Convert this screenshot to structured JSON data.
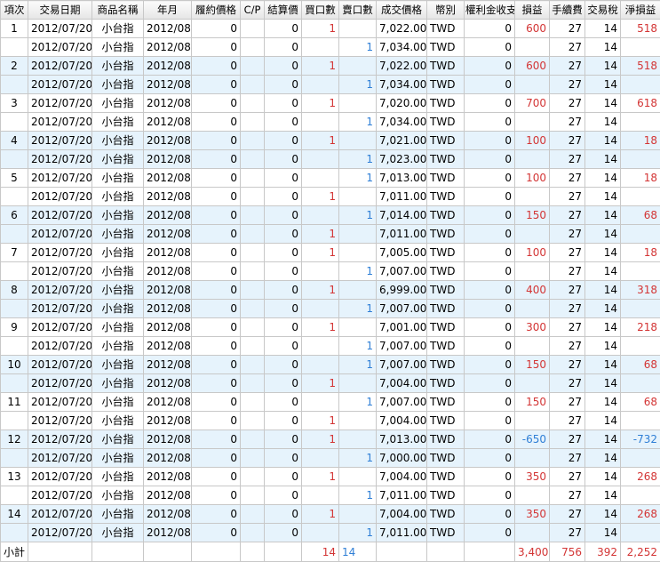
{
  "headers": [
    "項次",
    "交易日期",
    "商品名稱",
    "年月",
    "履約價格",
    "C/P",
    "結算價",
    "買口數",
    "賣口數",
    "成交價格",
    "幣別",
    "權利金收支",
    "損益",
    "手續費",
    "交易稅",
    "淨損益"
  ],
  "colors": {
    "positive": "#d33535",
    "negative": "#2f7fd6",
    "alt_row": "#e6f3fc",
    "grid": "#c8c8c8"
  },
  "rows": [
    {
      "idx": "1",
      "date": "2012/07/20",
      "product": "小台指",
      "ym": "2012/08",
      "strike": "0",
      "cp": "",
      "settle": "0",
      "buy": "1",
      "sell": "",
      "price": "7,022.00",
      "currency": "TWD",
      "premium": "0",
      "pl": "600",
      "fee": "27",
      "tax": "14",
      "net": "518",
      "pl_color": "red",
      "net_color": "red",
      "alt": false
    },
    {
      "idx": "",
      "date": "2012/07/20",
      "product": "小台指",
      "ym": "2012/08",
      "strike": "0",
      "cp": "",
      "settle": "0",
      "buy": "",
      "sell": "1",
      "price": "7,034.00",
      "currency": "TWD",
      "premium": "0",
      "pl": "",
      "fee": "27",
      "tax": "14",
      "net": "",
      "pl_color": "red",
      "net_color": "red",
      "alt": false
    },
    {
      "idx": "2",
      "date": "2012/07/20",
      "product": "小台指",
      "ym": "2012/08",
      "strike": "0",
      "cp": "",
      "settle": "0",
      "buy": "1",
      "sell": "",
      "price": "7,022.00",
      "currency": "TWD",
      "premium": "0",
      "pl": "600",
      "fee": "27",
      "tax": "14",
      "net": "518",
      "pl_color": "red",
      "net_color": "red",
      "alt": true
    },
    {
      "idx": "",
      "date": "2012/07/20",
      "product": "小台指",
      "ym": "2012/08",
      "strike": "0",
      "cp": "",
      "settle": "0",
      "buy": "",
      "sell": "1",
      "price": "7,034.00",
      "currency": "TWD",
      "premium": "0",
      "pl": "",
      "fee": "27",
      "tax": "14",
      "net": "",
      "pl_color": "red",
      "net_color": "red",
      "alt": true
    },
    {
      "idx": "3",
      "date": "2012/07/20",
      "product": "小台指",
      "ym": "2012/08",
      "strike": "0",
      "cp": "",
      "settle": "0",
      "buy": "1",
      "sell": "",
      "price": "7,020.00",
      "currency": "TWD",
      "premium": "0",
      "pl": "700",
      "fee": "27",
      "tax": "14",
      "net": "618",
      "pl_color": "red",
      "net_color": "red",
      "alt": false
    },
    {
      "idx": "",
      "date": "2012/07/20",
      "product": "小台指",
      "ym": "2012/08",
      "strike": "0",
      "cp": "",
      "settle": "0",
      "buy": "",
      "sell": "1",
      "price": "7,034.00",
      "currency": "TWD",
      "premium": "0",
      "pl": "",
      "fee": "27",
      "tax": "14",
      "net": "",
      "pl_color": "red",
      "net_color": "red",
      "alt": false
    },
    {
      "idx": "4",
      "date": "2012/07/20",
      "product": "小台指",
      "ym": "2012/08",
      "strike": "0",
      "cp": "",
      "settle": "0",
      "buy": "1",
      "sell": "",
      "price": "7,021.00",
      "currency": "TWD",
      "premium": "0",
      "pl": "100",
      "fee": "27",
      "tax": "14",
      "net": "18",
      "pl_color": "red",
      "net_color": "red",
      "alt": true
    },
    {
      "idx": "",
      "date": "2012/07/20",
      "product": "小台指",
      "ym": "2012/08",
      "strike": "0",
      "cp": "",
      "settle": "0",
      "buy": "",
      "sell": "1",
      "price": "7,023.00",
      "currency": "TWD",
      "premium": "0",
      "pl": "",
      "fee": "27",
      "tax": "14",
      "net": "",
      "pl_color": "red",
      "net_color": "red",
      "alt": true
    },
    {
      "idx": "5",
      "date": "2012/07/20",
      "product": "小台指",
      "ym": "2012/08",
      "strike": "0",
      "cp": "",
      "settle": "0",
      "buy": "",
      "sell": "1",
      "price": "7,013.00",
      "currency": "TWD",
      "premium": "0",
      "pl": "100",
      "fee": "27",
      "tax": "14",
      "net": "18",
      "pl_color": "red",
      "net_color": "red",
      "alt": false
    },
    {
      "idx": "",
      "date": "2012/07/20",
      "product": "小台指",
      "ym": "2012/08",
      "strike": "0",
      "cp": "",
      "settle": "0",
      "buy": "1",
      "sell": "",
      "price": "7,011.00",
      "currency": "TWD",
      "premium": "0",
      "pl": "",
      "fee": "27",
      "tax": "14",
      "net": "",
      "pl_color": "red",
      "net_color": "red",
      "alt": false
    },
    {
      "idx": "6",
      "date": "2012/07/20",
      "product": "小台指",
      "ym": "2012/08",
      "strike": "0",
      "cp": "",
      "settle": "0",
      "buy": "",
      "sell": "1",
      "price": "7,014.00",
      "currency": "TWD",
      "premium": "0",
      "pl": "150",
      "fee": "27",
      "tax": "14",
      "net": "68",
      "pl_color": "red",
      "net_color": "red",
      "alt": true
    },
    {
      "idx": "",
      "date": "2012/07/20",
      "product": "小台指",
      "ym": "2012/08",
      "strike": "0",
      "cp": "",
      "settle": "0",
      "buy": "1",
      "sell": "",
      "price": "7,011.00",
      "currency": "TWD",
      "premium": "0",
      "pl": "",
      "fee": "27",
      "tax": "14",
      "net": "",
      "pl_color": "red",
      "net_color": "red",
      "alt": true
    },
    {
      "idx": "7",
      "date": "2012/07/20",
      "product": "小台指",
      "ym": "2012/08",
      "strike": "0",
      "cp": "",
      "settle": "0",
      "buy": "1",
      "sell": "",
      "price": "7,005.00",
      "currency": "TWD",
      "premium": "0",
      "pl": "100",
      "fee": "27",
      "tax": "14",
      "net": "18",
      "pl_color": "red",
      "net_color": "red",
      "alt": false
    },
    {
      "idx": "",
      "date": "2012/07/20",
      "product": "小台指",
      "ym": "2012/08",
      "strike": "0",
      "cp": "",
      "settle": "0",
      "buy": "",
      "sell": "1",
      "price": "7,007.00",
      "currency": "TWD",
      "premium": "0",
      "pl": "",
      "fee": "27",
      "tax": "14",
      "net": "",
      "pl_color": "red",
      "net_color": "red",
      "alt": false
    },
    {
      "idx": "8",
      "date": "2012/07/20",
      "product": "小台指",
      "ym": "2012/08",
      "strike": "0",
      "cp": "",
      "settle": "0",
      "buy": "1",
      "sell": "",
      "price": "6,999.00",
      "currency": "TWD",
      "premium": "0",
      "pl": "400",
      "fee": "27",
      "tax": "14",
      "net": "318",
      "pl_color": "red",
      "net_color": "red",
      "alt": true
    },
    {
      "idx": "",
      "date": "2012/07/20",
      "product": "小台指",
      "ym": "2012/08",
      "strike": "0",
      "cp": "",
      "settle": "0",
      "buy": "",
      "sell": "1",
      "price": "7,007.00",
      "currency": "TWD",
      "premium": "0",
      "pl": "",
      "fee": "27",
      "tax": "14",
      "net": "",
      "pl_color": "red",
      "net_color": "red",
      "alt": true
    },
    {
      "idx": "9",
      "date": "2012/07/20",
      "product": "小台指",
      "ym": "2012/08",
      "strike": "0",
      "cp": "",
      "settle": "0",
      "buy": "1",
      "sell": "",
      "price": "7,001.00",
      "currency": "TWD",
      "premium": "0",
      "pl": "300",
      "fee": "27",
      "tax": "14",
      "net": "218",
      "pl_color": "red",
      "net_color": "red",
      "alt": false
    },
    {
      "idx": "",
      "date": "2012/07/20",
      "product": "小台指",
      "ym": "2012/08",
      "strike": "0",
      "cp": "",
      "settle": "0",
      "buy": "",
      "sell": "1",
      "price": "7,007.00",
      "currency": "TWD",
      "premium": "0",
      "pl": "",
      "fee": "27",
      "tax": "14",
      "net": "",
      "pl_color": "red",
      "net_color": "red",
      "alt": false
    },
    {
      "idx": "10",
      "date": "2012/07/20",
      "product": "小台指",
      "ym": "2012/08",
      "strike": "0",
      "cp": "",
      "settle": "0",
      "buy": "",
      "sell": "1",
      "price": "7,007.00",
      "currency": "TWD",
      "premium": "0",
      "pl": "150",
      "fee": "27",
      "tax": "14",
      "net": "68",
      "pl_color": "red",
      "net_color": "red",
      "alt": true
    },
    {
      "idx": "",
      "date": "2012/07/20",
      "product": "小台指",
      "ym": "2012/08",
      "strike": "0",
      "cp": "",
      "settle": "0",
      "buy": "1",
      "sell": "",
      "price": "7,004.00",
      "currency": "TWD",
      "premium": "0",
      "pl": "",
      "fee": "27",
      "tax": "14",
      "net": "",
      "pl_color": "red",
      "net_color": "red",
      "alt": true
    },
    {
      "idx": "11",
      "date": "2012/07/20",
      "product": "小台指",
      "ym": "2012/08",
      "strike": "0",
      "cp": "",
      "settle": "0",
      "buy": "",
      "sell": "1",
      "price": "7,007.00",
      "currency": "TWD",
      "premium": "0",
      "pl": "150",
      "fee": "27",
      "tax": "14",
      "net": "68",
      "pl_color": "red",
      "net_color": "red",
      "alt": false
    },
    {
      "idx": "",
      "date": "2012/07/20",
      "product": "小台指",
      "ym": "2012/08",
      "strike": "0",
      "cp": "",
      "settle": "0",
      "buy": "1",
      "sell": "",
      "price": "7,004.00",
      "currency": "TWD",
      "premium": "0",
      "pl": "",
      "fee": "27",
      "tax": "14",
      "net": "",
      "pl_color": "red",
      "net_color": "red",
      "alt": false
    },
    {
      "idx": "12",
      "date": "2012/07/20",
      "product": "小台指",
      "ym": "2012/08",
      "strike": "0",
      "cp": "",
      "settle": "0",
      "buy": "1",
      "sell": "",
      "price": "7,013.00",
      "currency": "TWD",
      "premium": "0",
      "pl": "-650",
      "fee": "27",
      "tax": "14",
      "net": "-732",
      "pl_color": "blue",
      "net_color": "blue",
      "alt": true
    },
    {
      "idx": "",
      "date": "2012/07/20",
      "product": "小台指",
      "ym": "2012/08",
      "strike": "0",
      "cp": "",
      "settle": "0",
      "buy": "",
      "sell": "1",
      "price": "7,000.00",
      "currency": "TWD",
      "premium": "0",
      "pl": "",
      "fee": "27",
      "tax": "14",
      "net": "",
      "pl_color": "red",
      "net_color": "red",
      "alt": true
    },
    {
      "idx": "13",
      "date": "2012/07/20",
      "product": "小台指",
      "ym": "2012/08",
      "strike": "0",
      "cp": "",
      "settle": "0",
      "buy": "1",
      "sell": "",
      "price": "7,004.00",
      "currency": "TWD",
      "premium": "0",
      "pl": "350",
      "fee": "27",
      "tax": "14",
      "net": "268",
      "pl_color": "red",
      "net_color": "red",
      "alt": false
    },
    {
      "idx": "",
      "date": "2012/07/20",
      "product": "小台指",
      "ym": "2012/08",
      "strike": "0",
      "cp": "",
      "settle": "0",
      "buy": "",
      "sell": "1",
      "price": "7,011.00",
      "currency": "TWD",
      "premium": "0",
      "pl": "",
      "fee": "27",
      "tax": "14",
      "net": "",
      "pl_color": "red",
      "net_color": "red",
      "alt": false
    },
    {
      "idx": "14",
      "date": "2012/07/20",
      "product": "小台指",
      "ym": "2012/08",
      "strike": "0",
      "cp": "",
      "settle": "0",
      "buy": "1",
      "sell": "",
      "price": "7,004.00",
      "currency": "TWD",
      "premium": "0",
      "pl": "350",
      "fee": "27",
      "tax": "14",
      "net": "268",
      "pl_color": "red",
      "net_color": "red",
      "alt": true
    },
    {
      "idx": "",
      "date": "2012/07/20",
      "product": "小台指",
      "ym": "2012/08",
      "strike": "0",
      "cp": "",
      "settle": "0",
      "buy": "",
      "sell": "1",
      "price": "7,011.00",
      "currency": "TWD",
      "premium": "0",
      "pl": "",
      "fee": "27",
      "tax": "14",
      "net": "",
      "pl_color": "red",
      "net_color": "red",
      "alt": true
    }
  ],
  "subtotal": {
    "label": "小計",
    "buy": "14",
    "sell": "14",
    "pl": "3,400",
    "fee": "756",
    "tax": "392",
    "net": "2,252"
  }
}
